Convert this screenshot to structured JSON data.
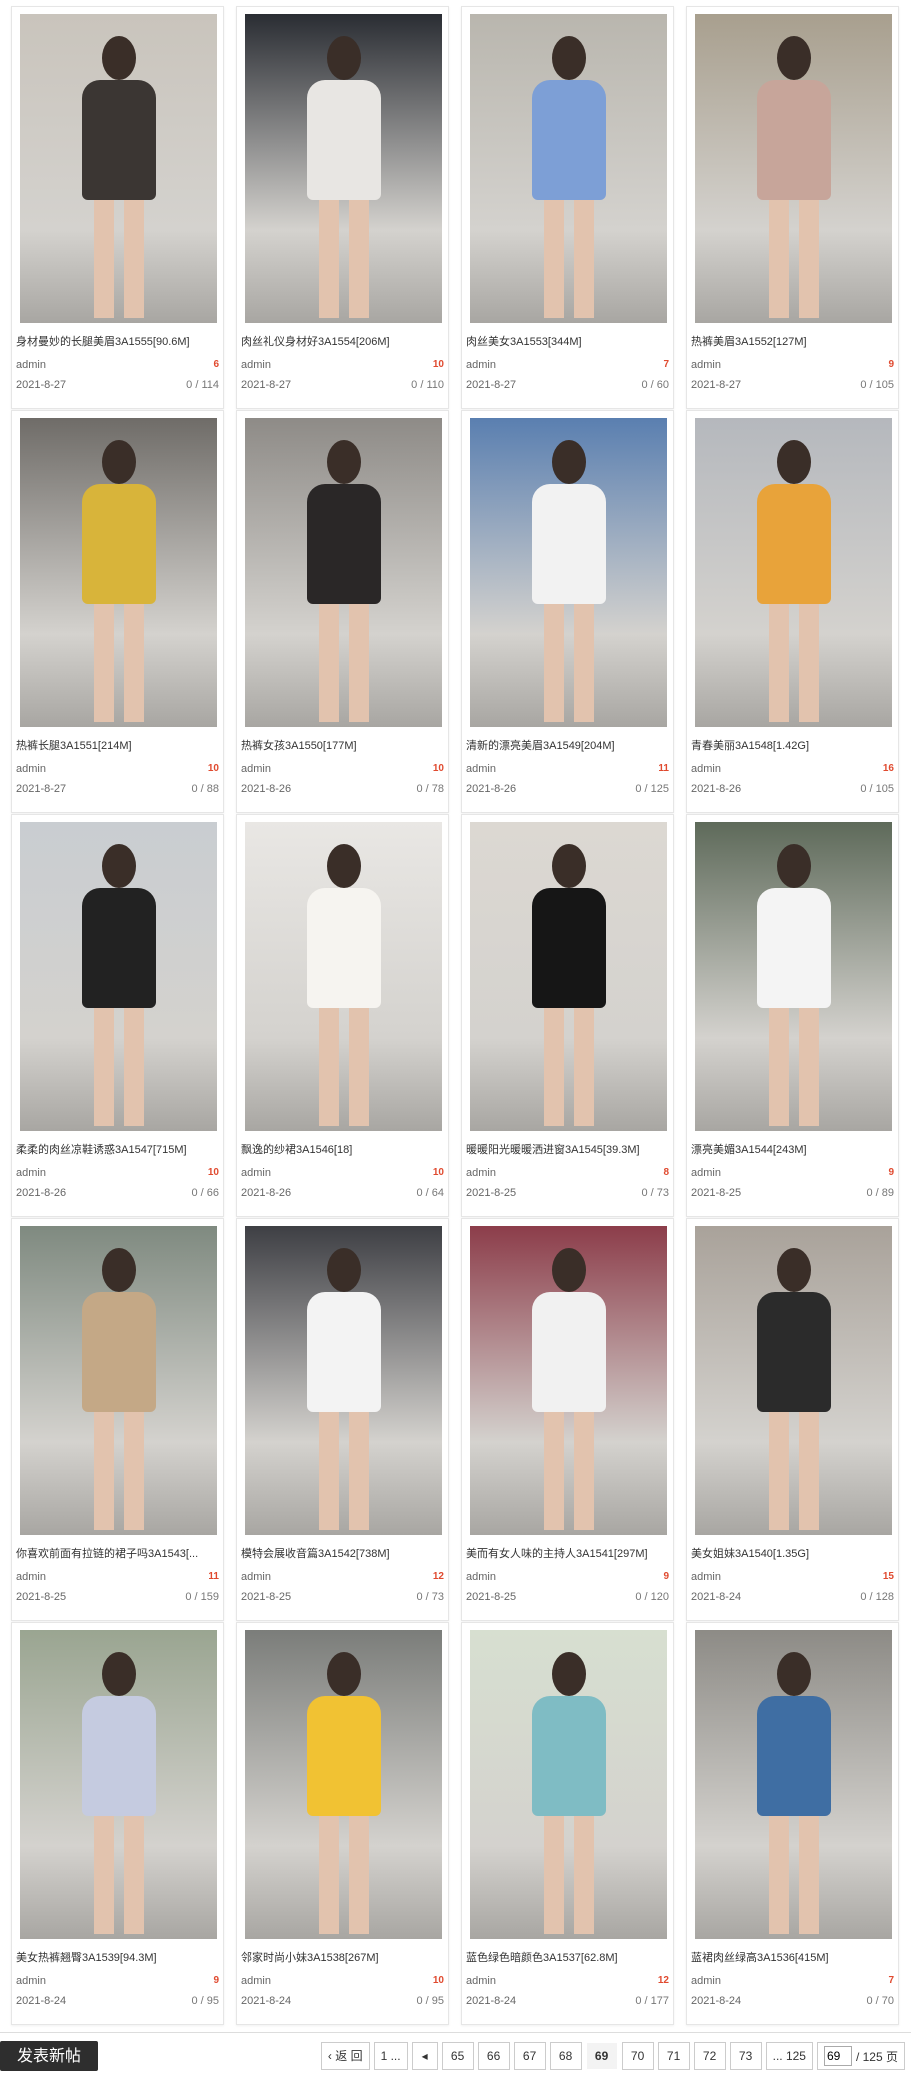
{
  "posts": [
    {
      "title": "身材曼妙的长腿美眉3A1555[90.6M]",
      "author": "admin",
      "replies": "6",
      "date": "2021-8-27",
      "views": "0 / 114",
      "bg": "#c9c4bc",
      "fig": "#3b3633",
      "icon": "photo-icon"
    },
    {
      "title": "肉丝礼仪身材好3A1554[206M]",
      "author": "admin",
      "replies": "10",
      "date": "2021-8-27",
      "views": "0 / 110",
      "bg": "#2a2d33",
      "fig": "#e8e6e3",
      "icon": "photo-icon"
    },
    {
      "title": "肉丝美女3A1553[344M]",
      "author": "admin",
      "replies": "7",
      "date": "2021-8-27",
      "views": "0 / 60",
      "bg": "#b9b6ae",
      "fig": "#7d9fd6",
      "icon": "photo-icon"
    },
    {
      "title": "热裤美眉3A1552[127M]",
      "author": "admin",
      "replies": "9",
      "date": "2021-8-27",
      "views": "0 / 105",
      "bg": "#a89f8e",
      "fig": "#c7a59a",
      "icon": "photo-icon"
    },
    {
      "title": "热裤长腿3A1551[214M]",
      "author": "admin",
      "replies": "10",
      "date": "2021-8-27",
      "views": "0 / 88",
      "bg": "#6f6c68",
      "fig": "#d8b43a",
      "icon": "photo-icon"
    },
    {
      "title": "热裤女孩3A1550[177M]",
      "author": "admin",
      "replies": "10",
      "date": "2021-8-26",
      "views": "0 / 78",
      "bg": "#8e8b87",
      "fig": "#2a2727",
      "icon": "photo-icon"
    },
    {
      "title": "清新的漂亮美眉3A1549[204M]",
      "author": "admin",
      "replies": "11",
      "date": "2021-8-26",
      "views": "0 / 125",
      "bg": "#5a7fb0",
      "fig": "#f2f2f2",
      "icon": "photo-icon"
    },
    {
      "title": "青春美丽3A1548[1.42G]",
      "author": "admin",
      "replies": "16",
      "date": "2021-8-26",
      "views": "0 / 105",
      "bg": "#b5b8bd",
      "fig": "#e8a33a",
      "icon": "photo-icon"
    },
    {
      "title": "柔柔的肉丝凉鞋诱惑3A1547[715M]",
      "author": "admin",
      "replies": "10",
      "date": "2021-8-26",
      "views": "0 / 66",
      "bg": "#c9cdd1",
      "fig": "#222222",
      "icon": "photo-icon"
    },
    {
      "title": "飘逸的纱裙3A1546[18]",
      "author": "admin",
      "replies": "10",
      "date": "2021-8-26",
      "views": "0 / 64",
      "bg": "#e9e7e4",
      "fig": "#f6f4f0",
      "icon": "photo-icon"
    },
    {
      "title": "暖暖阳光暖暖洒进窗3A1545[39.3M]",
      "author": "admin",
      "replies": "8",
      "date": "2021-8-25",
      "views": "0 / 73",
      "bg": "#dcd8d2",
      "fig": "#161616",
      "icon": "photo-icon"
    },
    {
      "title": "漂亮美媚3A1544[243M]",
      "author": "admin",
      "replies": "9",
      "date": "2021-8-25",
      "views": "0 / 89",
      "bg": "#5e6a5a",
      "fig": "#f4f4f4",
      "icon": "photo-icon"
    },
    {
      "title": "你喜欢前面有拉链的裙子吗3A1543[...",
      "author": "admin",
      "replies": "11",
      "date": "2021-8-25",
      "views": "0 / 159",
      "bg": "#7f8a80",
      "fig": "#c4a886",
      "icon": "photo-icon"
    },
    {
      "title": "模特会展收音篇3A1542[738M]",
      "author": "admin",
      "replies": "12",
      "date": "2021-8-25",
      "views": "0 / 73",
      "bg": "#3e3f44",
      "fig": "#f3f3f3",
      "icon": "photo-icon"
    },
    {
      "title": "美而有女人味的主持人3A1541[297M]",
      "author": "admin",
      "replies": "9",
      "date": "2021-8-25",
      "views": "0 / 120",
      "bg": "#8c3d4a",
      "fig": "#f1f1f1",
      "icon": "photo-icon"
    },
    {
      "title": "美女姐妹3A1540[1.35G]",
      "author": "admin",
      "replies": "15",
      "date": "2021-8-24",
      "views": "0 / 128",
      "bg": "#a9a29a",
      "fig": "#2b2b2b",
      "icon": "photo-icon"
    },
    {
      "title": "美女热裤翘臀3A1539[94.3M]",
      "author": "admin",
      "replies": "9",
      "date": "2021-8-24",
      "views": "0 / 95",
      "bg": "#9aa591",
      "fig": "#c5cbe0",
      "icon": "photo-icon"
    },
    {
      "title": "邻家时尚小妹3A1538[267M]",
      "author": "admin",
      "replies": "10",
      "date": "2021-8-24",
      "views": "0 / 95",
      "bg": "#7b7d7a",
      "fig": "#f1c233",
      "icon": "photo-icon"
    },
    {
      "title": "蓝色绿色暗颜色3A1537[62.8M]",
      "author": "admin",
      "replies": "12",
      "date": "2021-8-24",
      "views": "0 / 177",
      "bg": "#d7dfd0",
      "fig": "#7fbcc4",
      "icon": "photo-icon"
    },
    {
      "title": "蓝裙肉丝绿高3A1536[415M]",
      "author": "admin",
      "replies": "7",
      "date": "2021-8-24",
      "views": "0 / 70",
      "bg": "#8d8b86",
      "fig": "#3f6ea3",
      "icon": "photo-icon"
    }
  ],
  "toolbar": {
    "new_post_label": "发表新帖"
  },
  "pagination": {
    "back_label": "‹ 返 回",
    "first_label": "1 ...",
    "prev_icon": "◂",
    "pages": [
      "65",
      "66",
      "67",
      "68",
      "69",
      "70",
      "71",
      "72",
      "73"
    ],
    "current": "69",
    "last_label": "... 125",
    "input_value": "69",
    "total_label": "/ 125 页"
  }
}
